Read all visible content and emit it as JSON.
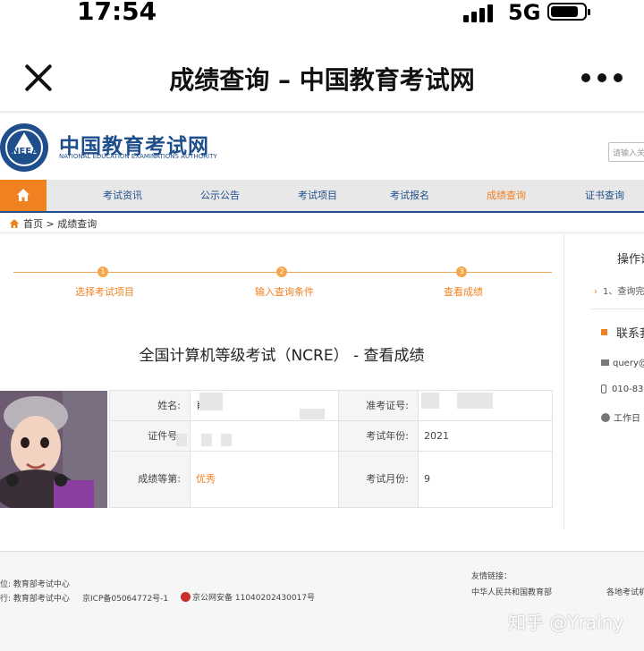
{
  "status_bar": {
    "time": "17:54",
    "network": "5G"
  },
  "nav_bar": {
    "title": "成绩查询 – 中国教育考试网"
  },
  "site": {
    "logo_badge_text": "NEEA",
    "logo_cn": "中国教育考试网",
    "logo_en": "NATIONAL EDUCATION EXAMINATIONS AUTHORITY",
    "search_placeholder": "请输入关键"
  },
  "main_nav": {
    "items": [
      {
        "label": "考试资讯"
      },
      {
        "label": "公示公告"
      },
      {
        "label": "考试项目"
      },
      {
        "label": "考试报名"
      },
      {
        "label": "成绩查询"
      },
      {
        "label": "证书查询"
      }
    ],
    "active_color": "#f08120",
    "home_color": "#f08120",
    "brand_color": "#1f4e8c"
  },
  "breadcrumb": {
    "home": "首页",
    "separator": ">",
    "current": "成绩查询"
  },
  "steps": [
    {
      "num": "1",
      "label": "选择考试项目"
    },
    {
      "num": "2",
      "label": "输入查询条件"
    },
    {
      "num": "3",
      "label": "查看成绩"
    }
  ],
  "sidebar": {
    "title": "操作说",
    "link": "1、查询完",
    "contact_title": "联系我",
    "email": "query@",
    "phone": "010-830",
    "hours": "工作日 ("
  },
  "result": {
    "title": "全国计算机等级考试（NCRE） - 查看成绩",
    "name_label": "姓名:",
    "name_value": "肖",
    "ticket_label": "准考证号:",
    "id_label": "证件号:",
    "year_label": "考试年份:",
    "year_value": "2021",
    "grade_label": "成绩等第:",
    "grade_value": "优秀",
    "month_label": "考试月份:",
    "month_value": "9"
  },
  "footer": {
    "line1_prefix": "位:",
    "line1_value": "教育部考试中心",
    "line2_prefix": "行:",
    "line2_value": "教育部考试中心",
    "icp": "京ICP备05064772号-1",
    "police": "京公网安备 11040202430017号",
    "friends_label": "友情链接：",
    "friend1": "中华人民共和国教育部",
    "friend2": "各地考试机"
  },
  "watermark": "知乎 @Yrainy"
}
